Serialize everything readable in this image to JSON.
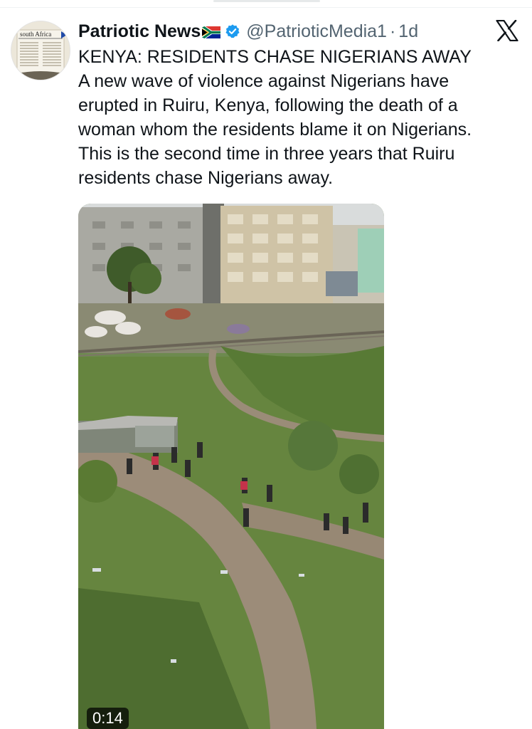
{
  "tweet": {
    "author": {
      "display_name": "Patriotic News",
      "handle": "@PatrioticMedia1",
      "avatar_text": "south Africa",
      "flag_icon": "south-africa-flag-icon",
      "verified_icon": "verified-badge-icon"
    },
    "separator": "·",
    "time": "1d",
    "text_lines": [
      "KENYA: RESIDENTS CHASE NIGERIANS AWAY",
      "A new wave of violence against Nigerians have",
      "erupted in Ruiru, Kenya, following the death of a",
      "woman whom the residents blame it on Nigerians.",
      "This is the second time in three years that Ruiru",
      "residents chase Nigerians away."
    ],
    "media": {
      "type": "video",
      "duration": "0:14"
    }
  },
  "platform_icon": "x-logo-icon",
  "colors": {
    "text_primary": "#0f1419",
    "text_secondary": "#536471",
    "verified_blue": "#1d9bf0",
    "divider": "#eff3f4"
  }
}
